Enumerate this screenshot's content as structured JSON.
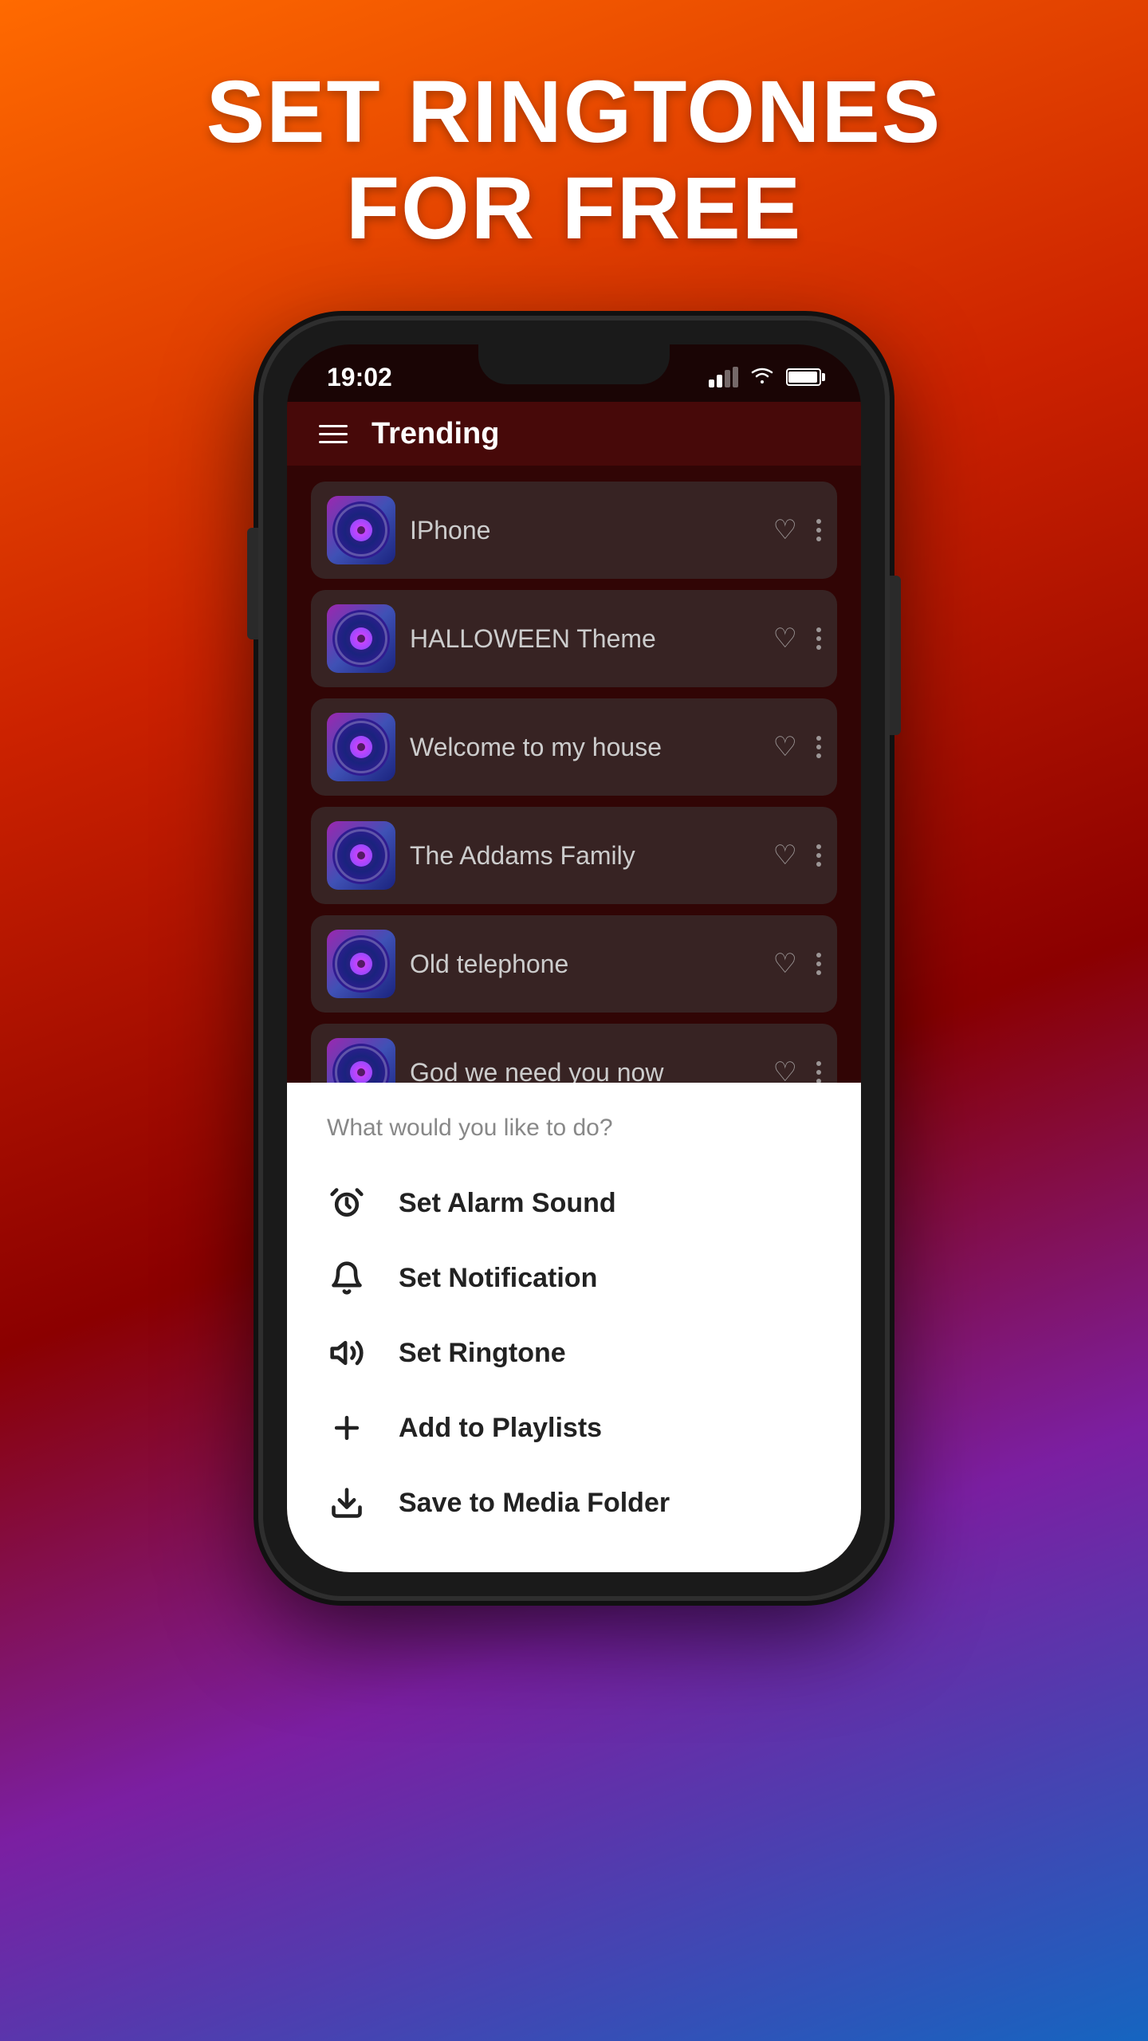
{
  "headline": {
    "line1": "SET RINGTONES",
    "line2": "FOR FREE"
  },
  "statusBar": {
    "time": "19:02",
    "wifi": "wifi",
    "battery": "battery"
  },
  "header": {
    "title": "Trending"
  },
  "songs": [
    {
      "id": 1,
      "name": "IPhone"
    },
    {
      "id": 2,
      "name": "HALLOWEEN Theme"
    },
    {
      "id": 3,
      "name": "Welcome to my house"
    },
    {
      "id": 4,
      "name": "The Addams Family"
    },
    {
      "id": 5,
      "name": "Old telephone"
    },
    {
      "id": 6,
      "name": "God we need you now"
    }
  ],
  "bottomSheet": {
    "prompt": "What would you like to do?",
    "actions": [
      {
        "id": "alarm",
        "label": "Set Alarm Sound",
        "icon": "alarm"
      },
      {
        "id": "notification",
        "label": "Set Notification",
        "icon": "bell"
      },
      {
        "id": "ringtone",
        "label": "Set Ringtone",
        "icon": "volume"
      },
      {
        "id": "playlist",
        "label": "Add to Playlists",
        "icon": "plus"
      },
      {
        "id": "save",
        "label": "Save to Media Folder",
        "icon": "download"
      }
    ]
  }
}
